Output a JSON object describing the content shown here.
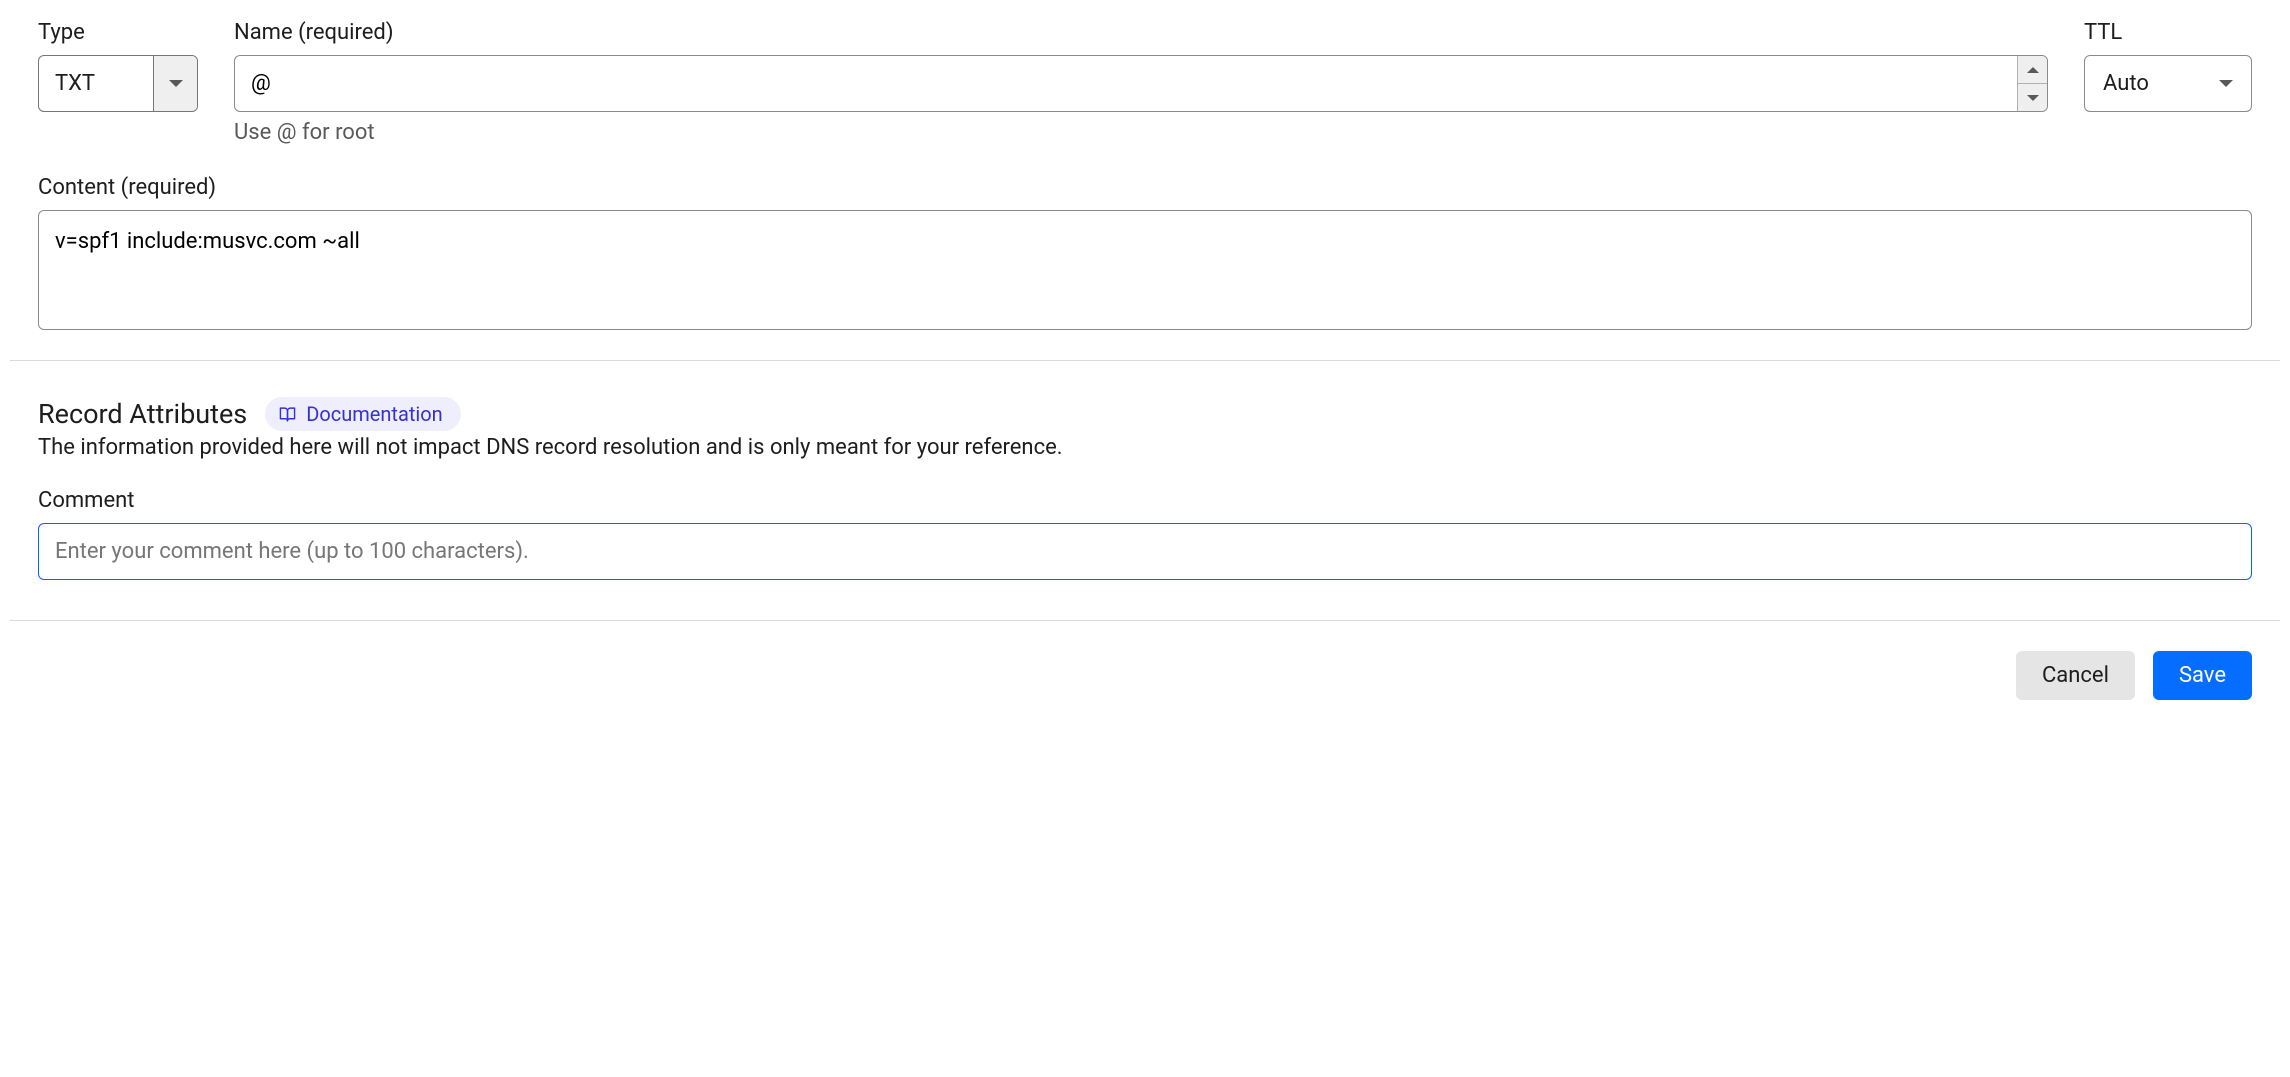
{
  "labels": {
    "type": "Type",
    "name": "Name (required)",
    "ttl": "TTL",
    "content": "Content (required)",
    "comment": "Comment"
  },
  "type": {
    "value": "TXT"
  },
  "name": {
    "value": "@",
    "helper": "Use @ for root"
  },
  "ttl": {
    "value": "Auto"
  },
  "content": {
    "value": "v=spf1 include:musvc.com ~all"
  },
  "attributes": {
    "title": "Record Attributes",
    "doc_label": "Documentation",
    "description": "The information provided here will not impact DNS record resolution and is only meant for your reference."
  },
  "comment": {
    "value": "",
    "placeholder": "Enter your comment here (up to 100 characters)."
  },
  "buttons": {
    "cancel": "Cancel",
    "save": "Save"
  }
}
